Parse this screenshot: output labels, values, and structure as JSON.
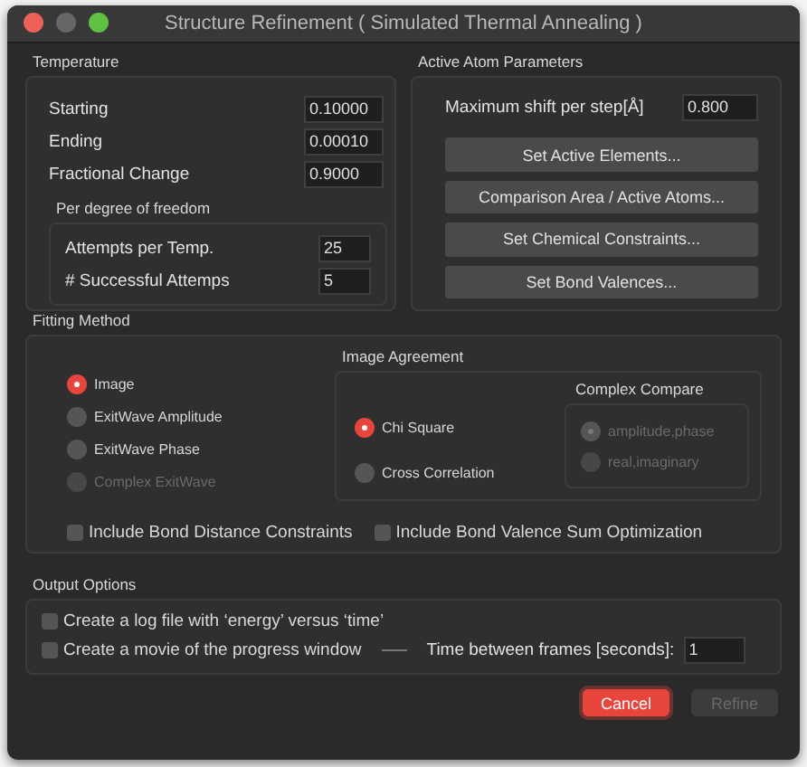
{
  "window": {
    "title": "Structure Refinement ( Simulated Thermal Annealing )"
  },
  "temperature": {
    "title": "Temperature",
    "fields": [
      {
        "label": "Starting",
        "value": "0.10000"
      },
      {
        "label": "Ending",
        "value": "0.00010"
      },
      {
        "label": "Fractional Change",
        "value": "0.9000"
      }
    ],
    "per_dof": {
      "title": "Per degree of freedom",
      "fields": [
        {
          "label": "Attempts per Temp.",
          "value": "25"
        },
        {
          "label": "# Successful Attemps",
          "value": "5"
        }
      ]
    }
  },
  "active_atoms": {
    "title": "Active Atom Parameters",
    "max_shift": {
      "label": "Maximum shift per step[Å]",
      "value": "0.800"
    },
    "buttons": [
      "Set Active Elements...",
      "Comparison Area / Active Atoms...",
      "Set Chemical Constraints...",
      "Set Bond Valences..."
    ]
  },
  "fitting": {
    "title": "Fitting Method",
    "methods": [
      {
        "label": "Image",
        "selected": true,
        "disabled": false
      },
      {
        "label": "ExitWave Amplitude",
        "selected": false,
        "disabled": false
      },
      {
        "label": "ExitWave Phase",
        "selected": false,
        "disabled": false
      },
      {
        "label": "Complex ExitWave",
        "selected": false,
        "disabled": true
      }
    ],
    "image_agreement": {
      "title": "Image Agreement",
      "options": [
        {
          "label": "Chi Square",
          "selected": true,
          "disabled": false
        },
        {
          "label": "Cross Correlation",
          "selected": false,
          "disabled": false
        }
      ],
      "complex_compare": {
        "title": "Complex Compare",
        "options": [
          {
            "label": "amplitude,phase",
            "selected": true,
            "disabled": true
          },
          {
            "label": "real,imaginary",
            "selected": false,
            "disabled": true
          }
        ]
      }
    },
    "checkboxes": [
      {
        "label": "Include Bond Distance Constraints",
        "checked": false
      },
      {
        "label": "Include Bond Valence Sum Optimization",
        "checked": false
      }
    ]
  },
  "output": {
    "title": "Output Options",
    "checkboxes": [
      {
        "label": "Create a log file with ‘energy’ versus ‘time’",
        "checked": false
      },
      {
        "label": "Create a movie of the progress window",
        "checked": false
      }
    ],
    "frame_time": {
      "label": "Time between frames [seconds]:",
      "value": "1"
    }
  },
  "buttons": [
    {
      "label": "Cancel",
      "default": true,
      "disabled": false
    },
    {
      "label": "Refine",
      "default": false,
      "disabled": true
    }
  ]
}
